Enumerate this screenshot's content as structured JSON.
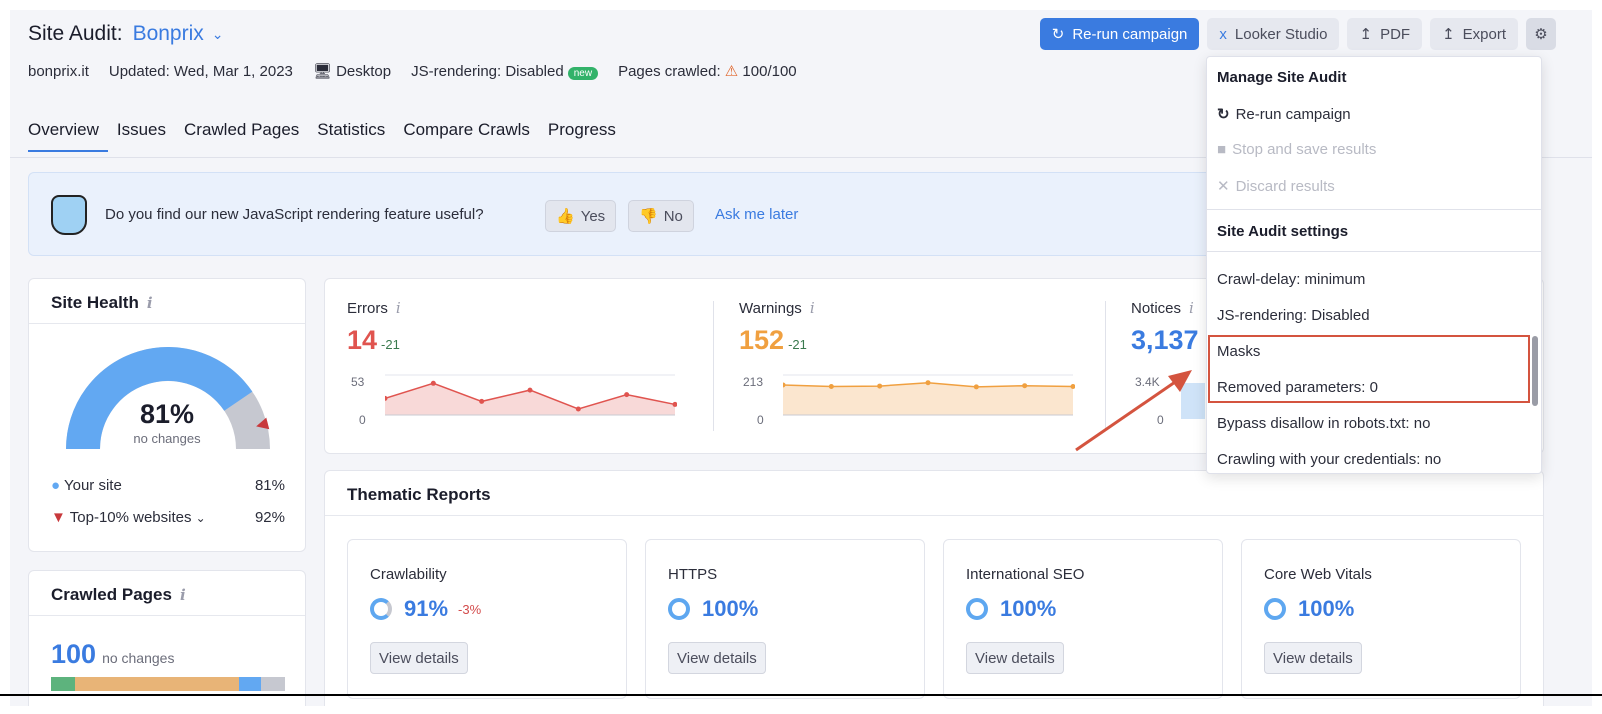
{
  "header": {
    "title_label": "Site Audit:",
    "project_name": "Bonprix",
    "domain": "bonprix.it",
    "updated": "Updated: Wed, Mar 1, 2023",
    "device": "Desktop",
    "js_rendering": "JS-rendering: Disabled",
    "new_badge": "new",
    "pages_crawled_label": "Pages crawled:",
    "pages_crawled_value": "100/100"
  },
  "actions": {
    "rerun": "Re-run campaign",
    "looker": "Looker Studio",
    "pdf": "PDF",
    "export": "Export"
  },
  "tabs": [
    "Overview",
    "Issues",
    "Crawled Pages",
    "Statistics",
    "Compare Crawls",
    "Progress"
  ],
  "banner": {
    "question": "Do you find our new JavaScript rendering feature useful?",
    "yes": "Yes",
    "no": "No",
    "later": "Ask me later"
  },
  "site_health": {
    "title": "Site Health",
    "percent": "81%",
    "change": "no changes",
    "your_site_label": "Your site",
    "your_site_value": "81%",
    "top10_label": "Top-10% websites",
    "top10_value": "92%",
    "your_site_fraction": 0.81,
    "top10_fraction": 0.92
  },
  "crawled_pages": {
    "title": "Crawled Pages",
    "count": "100",
    "change": "no changes"
  },
  "metrics": {
    "errors": {
      "label": "Errors",
      "value": "14",
      "delta": "-21",
      "ymax": "53",
      "ymin": "0",
      "series": [
        22,
        42,
        18,
        33,
        8,
        27,
        14
      ]
    },
    "warnings": {
      "label": "Warnings",
      "value": "152",
      "delta": "-21",
      "ymax": "213",
      "ymin": "0",
      "series": [
        160,
        152,
        154,
        172,
        150,
        156,
        152
      ]
    },
    "notices": {
      "label": "Notices",
      "value": "3,137",
      "ymax": "3.4K",
      "ymin": "0"
    }
  },
  "thematic": {
    "title": "Thematic Reports",
    "view_details": "View details",
    "reports": [
      {
        "name": "Crawlability",
        "value": "91%",
        "delta": "-3%"
      },
      {
        "name": "HTTPS",
        "value": "100%",
        "delta": ""
      },
      {
        "name": "International SEO",
        "value": "100%",
        "delta": ""
      },
      {
        "name": "Core Web Vitals",
        "value": "100%",
        "delta": ""
      }
    ]
  },
  "dropdown": {
    "manage_title": "Manage Site Audit",
    "rerun": "Re-run campaign",
    "stop": "Stop and save results",
    "discard": "Discard results",
    "settings_title": "Site Audit settings",
    "crawl_delay": "Crawl-delay: minimum",
    "js_rendering": "JS-rendering: Disabled",
    "masks": "Masks",
    "removed_params": "Removed parameters: 0",
    "bypass": "Bypass disallow in robots.txt: no",
    "credentials": "Crawling with your credentials: no"
  },
  "colors": {
    "accent": "#3a7be0",
    "error": "#e0544f",
    "warning": "#f0a040",
    "highlight": "#d4543f"
  }
}
